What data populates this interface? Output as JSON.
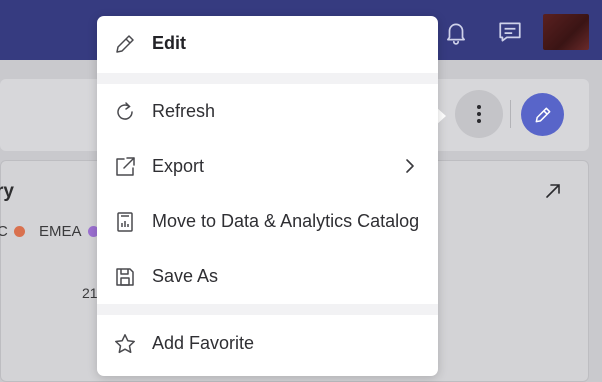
{
  "topbar": {
    "icons": [
      "bell-icon",
      "chat-icon"
    ],
    "colors": {
      "background": "#363b80"
    }
  },
  "toolbar": {
    "more_icon": "vertical-dots-icon",
    "edit_icon": "pencil-icon",
    "accent": "#5865c9"
  },
  "card": {
    "title_fragment": "ry",
    "legend": [
      {
        "label": "C",
        "color": "#d9714f"
      },
      {
        "label": "EMEA",
        "color": "#9b6fd1"
      }
    ],
    "tick_label": "21"
  },
  "menu": {
    "items": [
      {
        "label": "Edit",
        "icon": "pencil-icon"
      },
      {
        "label": "Refresh",
        "icon": "refresh-icon"
      },
      {
        "label": "Export",
        "icon": "export-icon",
        "has_submenu": true
      },
      {
        "label": "Move to Data & Analytics Catalog",
        "icon": "catalog-icon"
      },
      {
        "label": "Save As",
        "icon": "save-icon"
      },
      {
        "label": "Add Favorite",
        "icon": "star-icon"
      }
    ]
  }
}
